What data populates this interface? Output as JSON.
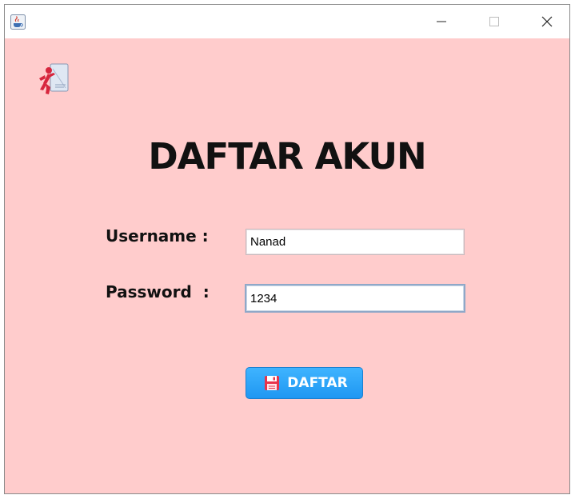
{
  "window": {
    "title": "",
    "controls": {
      "minimize": "minimize-icon",
      "maximize": "maximize-icon",
      "close": "close-icon"
    }
  },
  "icons": {
    "title_icon": "java-coffee-cup-icon",
    "app_icon": "running-person-icon",
    "button_icon": "floppy-disk-icon"
  },
  "form": {
    "heading": "DAFTAR AKUN",
    "username_label": "Username :",
    "username_value": "Nanad",
    "password_label": "Password  :",
    "password_value": "1234",
    "submit_label": "DAFTAR"
  },
  "colors": {
    "background": "#ffcccc",
    "button": "#2aa5fb",
    "button_icon": "#e8334a",
    "heading": "#111111"
  }
}
